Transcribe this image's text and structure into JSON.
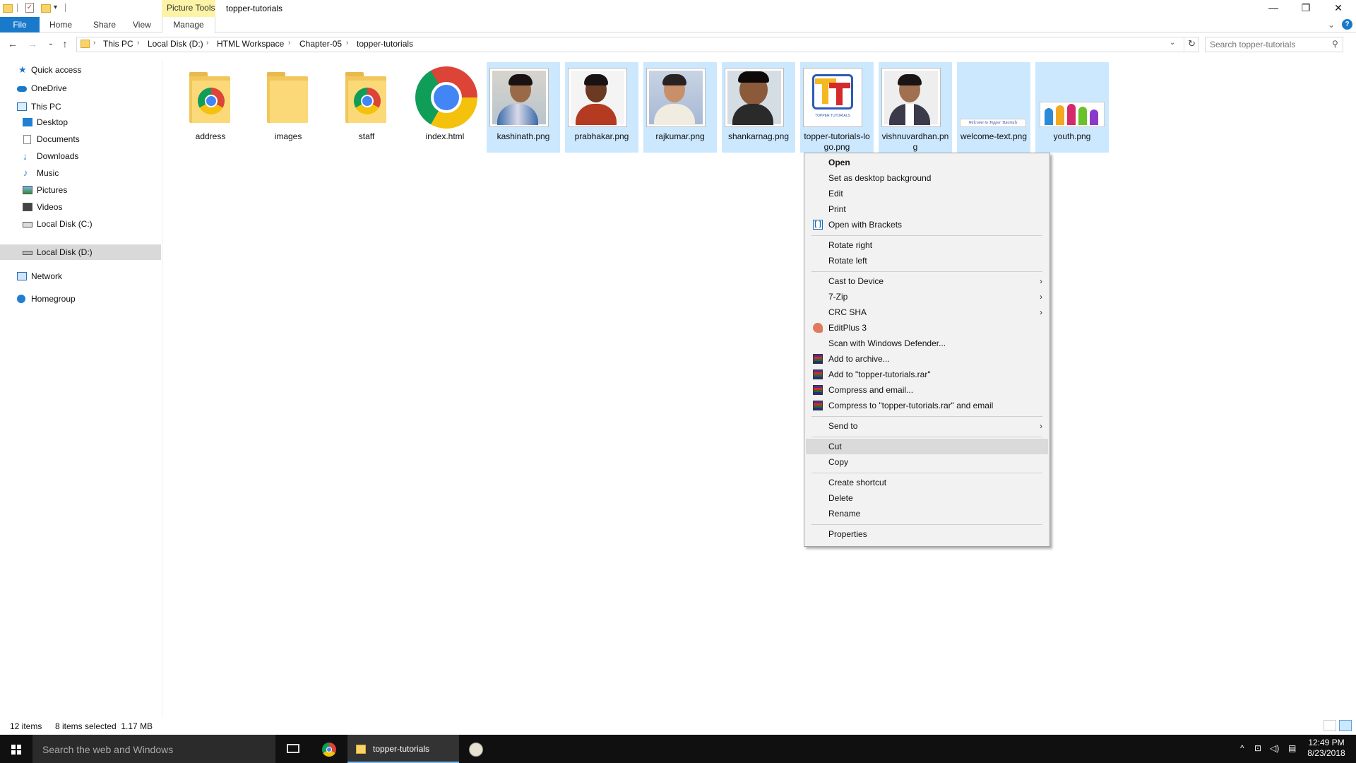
{
  "window": {
    "title": "topper-tutorials",
    "context_tab": "Picture Tools",
    "minimize": "—",
    "restore": "❐",
    "close": "✕"
  },
  "ribbon": {
    "tabs": [
      "File",
      "Home",
      "Share",
      "View",
      "Manage"
    ],
    "collapse_glyph": "⌄",
    "help_glyph": "?"
  },
  "address": {
    "crumbs": [
      "This PC",
      "Local Disk (D:)",
      "HTML Workspace",
      "Chapter-05",
      "topper-tutorials"
    ],
    "separator": "›",
    "search_placeholder": "Search topper-tutorials"
  },
  "nav": {
    "back": "←",
    "forward": "→",
    "recent": "⌄",
    "up": "↑",
    "refresh": "↻",
    "search_glyph": "⚲"
  },
  "navpane": {
    "quick_access": "Quick access",
    "onedrive": "OneDrive",
    "this_pc": "This PC",
    "desktop": "Desktop",
    "documents": "Documents",
    "downloads": "Downloads",
    "music": "Music",
    "pictures": "Pictures",
    "videos": "Videos",
    "local_c": "Local Disk (C:)",
    "local_d": "Local Disk (D:)",
    "network": "Network",
    "homegroup": "Homegroup",
    "selected": "Local Disk (D:)"
  },
  "files": [
    {
      "name": "address",
      "kind": "folder-chrome",
      "selected": false
    },
    {
      "name": "images",
      "kind": "folder",
      "selected": false
    },
    {
      "name": "staff",
      "kind": "folder-chrome",
      "selected": false
    },
    {
      "name": "index.html",
      "kind": "chrome-html",
      "selected": false
    },
    {
      "name": "kashinath.png",
      "kind": "photo",
      "selected": true
    },
    {
      "name": "prabhakar.png",
      "kind": "photo",
      "selected": true
    },
    {
      "name": "rajkumar.png",
      "kind": "photo",
      "selected": true
    },
    {
      "name": "shankarnag.png",
      "kind": "photo",
      "selected": true
    },
    {
      "name": "topper-tutorials-logo.png",
      "kind": "logo",
      "selected": true
    },
    {
      "name": "vishnuvardhan.png",
      "kind": "photo",
      "selected": true
    },
    {
      "name": "welcome-text.png",
      "kind": "welcome",
      "selected": true
    },
    {
      "name": "youth.png",
      "kind": "youth",
      "selected": true
    }
  ],
  "thumb_text": {
    "logo_caption": "TOPPER TUTORIALS",
    "welcome": "Welcome to Topper Tutorials"
  },
  "context_menu": {
    "open": "Open",
    "set_bg": "Set as desktop background",
    "edit": "Edit",
    "print": "Print",
    "open_brackets": "Open with Brackets",
    "rotate_right": "Rotate right",
    "rotate_left": "Rotate left",
    "cast": "Cast to Device",
    "zip": "7-Zip",
    "crc": "CRC SHA",
    "editplus": "EditPlus 3",
    "defender": "Scan with Windows Defender...",
    "add_archive": "Add to archive...",
    "add_rar": "Add to \"topper-tutorials.rar\"",
    "compress_email": "Compress and email...",
    "compress_rar_email": "Compress to \"topper-tutorials.rar\" and email",
    "send_to": "Send to",
    "cut": "Cut",
    "copy": "Copy",
    "create_shortcut": "Create shortcut",
    "delete": "Delete",
    "rename": "Rename",
    "properties": "Properties",
    "submenu_arrow": "›",
    "hovered": "Cut"
  },
  "status": {
    "item_count": "12 items",
    "selection": "8 items selected  1.17 MB"
  },
  "taskbar": {
    "search_placeholder": "Search the web and Windows",
    "explorer_label": "topper-tutorials",
    "time": "12:49 PM",
    "date": "8/23/2018",
    "tray_up": "^",
    "tray_network": "⊡",
    "tray_volume": "◁)",
    "tray_notify": "▤"
  },
  "colors": {
    "accent": "#1979ca",
    "selection": "#cce8ff",
    "context_tab": "#fcf3a6"
  }
}
